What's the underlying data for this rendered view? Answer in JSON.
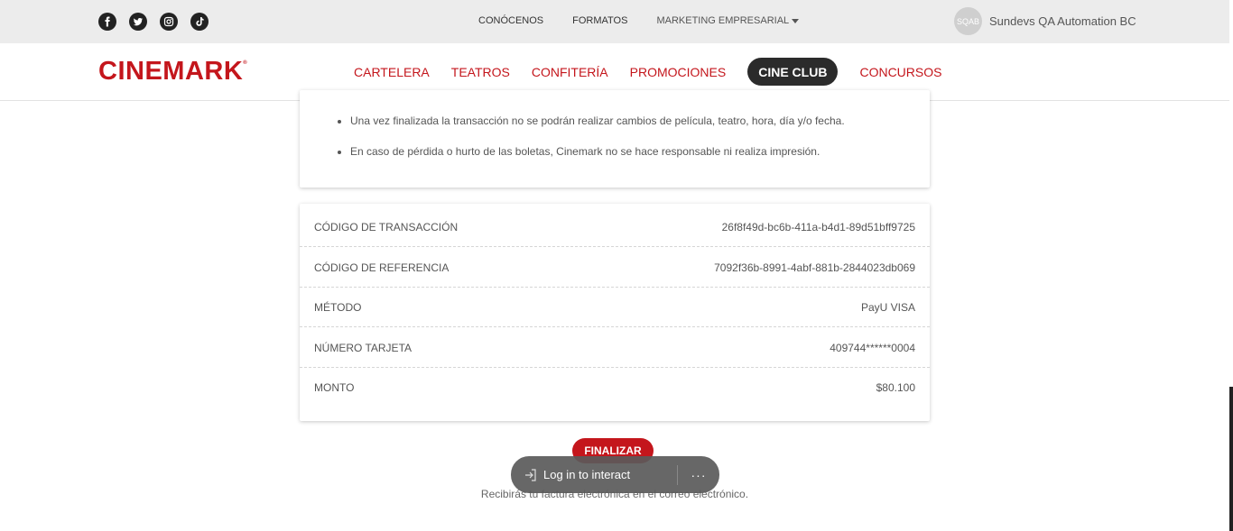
{
  "topbar": {
    "social": [
      "facebook-icon",
      "twitter-icon",
      "instagram-icon",
      "tiktok-icon"
    ],
    "nav": [
      "CONÓCENOS",
      "FORMATOS"
    ],
    "dropdown_label": "MARKETING EMPRESARIAL",
    "avatar_initials": "SQAB",
    "username": "Sundevs QA Automation BC"
  },
  "header": {
    "logo": "CINEMARK",
    "nav": [
      "CARTELERA",
      "TEATROS",
      "CONFITERÍA",
      "PROMOCIONES"
    ],
    "active": "CINE CLUB",
    "last": "CONCURSOS"
  },
  "notes": [
    "Una vez finalizada la transacción no se podrán realizar cambios de película, teatro, hora, día y/o fecha.",
    "En caso de pérdida o hurto de las boletas, Cinemark no se hace responsable ni realiza impresión."
  ],
  "details": [
    {
      "label": "CÓDIGO DE TRANSACCIÓN",
      "value": "26f8f49d-bc6b-411a-b4d1-89d51bff9725"
    },
    {
      "label": "CÓDIGO DE REFERENCIA",
      "value": "7092f36b-8991-4abf-881b-2844023db069"
    },
    {
      "label": "MÉTODO",
      "value": "PayU VISA"
    },
    {
      "label": "NÚMERO TARJETA",
      "value": "409744******0004"
    },
    {
      "label": "MONTO",
      "value": "$80.100"
    }
  ],
  "finalize_label": "FINALIZAR",
  "invoice_note": "Recibirás tu factura electrónica en el correo electrónico.",
  "overlay": {
    "login_label": "Log in to interact",
    "more_label": "···"
  },
  "colors": {
    "brand": "#c4161c",
    "pill": "#2b2b2b"
  }
}
